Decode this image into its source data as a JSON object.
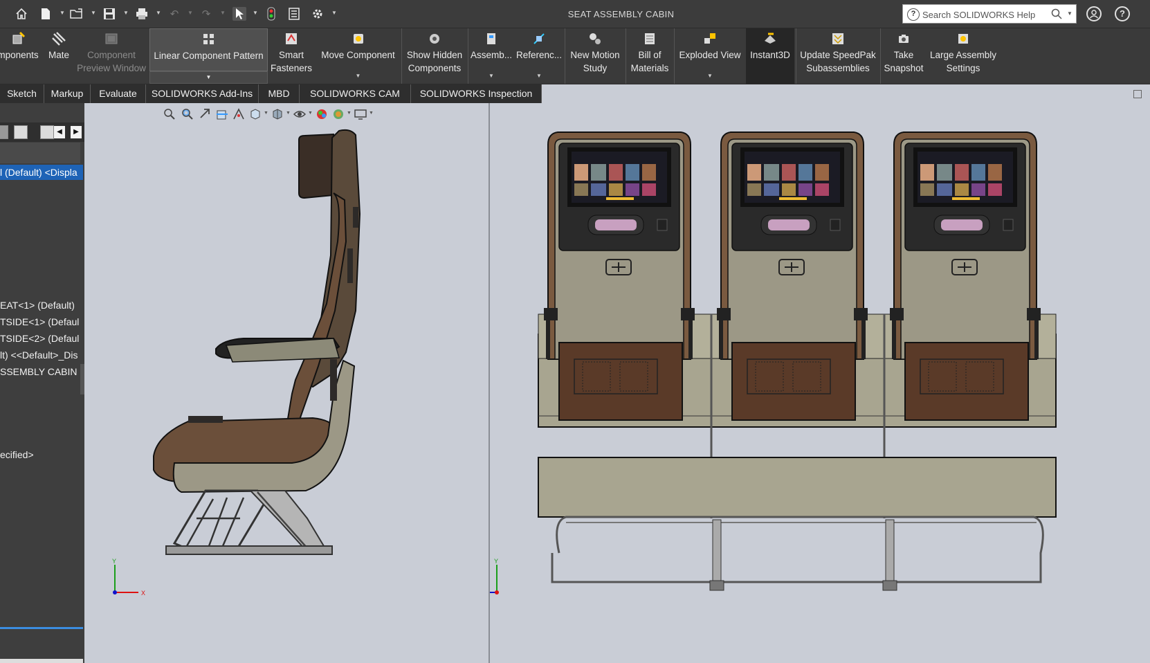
{
  "window": {
    "title": "SEAT ASSEMBLY CABIN",
    "search_placeholder": "Search SOLIDWORKS Help"
  },
  "quick_access": [
    {
      "icon": "home-icon"
    },
    {
      "icon": "new-document-icon"
    },
    {
      "icon": "open-icon"
    },
    {
      "icon": "save-icon"
    },
    {
      "icon": "print-icon"
    },
    {
      "icon": "undo-icon"
    },
    {
      "icon": "redo-icon"
    },
    {
      "icon": "select-icon"
    },
    {
      "icon": "rebuild-icon"
    },
    {
      "icon": "file-properties-icon"
    },
    {
      "icon": "options-gear-icon"
    }
  ],
  "ribbon": {
    "items": [
      {
        "id": "insert-components",
        "label_line1": "mponents",
        "label_line2": "",
        "icon": "insert-components-icon"
      },
      {
        "id": "mate",
        "label_line1": "Mate",
        "label_line2": "",
        "icon": "mate-icon"
      },
      {
        "id": "component-preview-window",
        "label_line1": "Component",
        "label_line2": "Preview Window",
        "icon": "component-preview-icon",
        "disabled": true
      },
      {
        "id": "linear-component-pattern",
        "label_line1": "Linear Component Pattern",
        "label_line2": "",
        "icon": "linear-pattern-icon"
      },
      {
        "id": "smart-fasteners",
        "label_line1": "Smart",
        "label_line2": "Fasteners",
        "icon": "smart-fasteners-icon"
      },
      {
        "id": "move-component",
        "label_line1": "Move Component",
        "label_line2": "",
        "icon": "move-component-icon"
      },
      {
        "id": "show-hidden-components",
        "label_line1": "Show Hidden",
        "label_line2": "Components",
        "icon": "show-hidden-icon"
      },
      {
        "id": "assembly-features",
        "label_line1": "Assemb...",
        "label_line2": "",
        "icon": "assembly-features-icon"
      },
      {
        "id": "reference-geometry",
        "label_line1": "Referenc...",
        "label_line2": "",
        "icon": "reference-geometry-icon"
      },
      {
        "id": "new-motion-study",
        "label_line1": "New Motion",
        "label_line2": "Study",
        "icon": "motion-study-icon"
      },
      {
        "id": "bill-of-materials",
        "label_line1": "Bill of",
        "label_line2": "Materials",
        "icon": "bom-icon"
      },
      {
        "id": "exploded-view",
        "label_line1": "Exploded View",
        "label_line2": "",
        "icon": "exploded-view-icon"
      },
      {
        "id": "instant3d",
        "label_line1": "Instant3D",
        "label_line2": "",
        "icon": "instant3d-icon",
        "pressed": true
      },
      {
        "id": "update-speedpak",
        "label_line1": "Update SpeedPak",
        "label_line2": "Subassemblies",
        "icon": "speedpak-icon"
      },
      {
        "id": "take-snapshot",
        "label_line1": "Take",
        "label_line2": "Snapshot",
        "icon": "camera-icon"
      },
      {
        "id": "large-assembly-settings",
        "label_line1": "Large Assembly",
        "label_line2": "Settings",
        "icon": "large-assembly-icon"
      }
    ]
  },
  "tabs": [
    "Sketch",
    "Markup",
    "Evaluate",
    "SOLIDWORKS Add-Ins",
    "MBD",
    "SOLIDWORKS CAM",
    "SOLIDWORKS Inspection"
  ],
  "feature_tree": {
    "rows": [
      {
        "text": "l (Default) <Displa",
        "selected": true
      },
      {
        "text": "EAT<1> (Default)"
      },
      {
        "text": "TSIDE<1> (Defaul"
      },
      {
        "text": "TSIDE<2> (Defaul"
      },
      {
        "text": "lt) <<Default>_Dis"
      },
      {
        "text": "SSEMBLY CABIN"
      },
      {
        "text": "ecified>"
      }
    ]
  },
  "view_toolbar": [
    {
      "icon": "zoom-to-fit-icon"
    },
    {
      "icon": "zoom-to-area-icon"
    },
    {
      "icon": "previous-view-icon"
    },
    {
      "icon": "section-view-icon"
    },
    {
      "icon": "dynamic-annotation-icon"
    },
    {
      "icon": "view-orientation-icon"
    },
    {
      "icon": "display-style-icon"
    },
    {
      "icon": "hide-show-items-icon"
    },
    {
      "icon": "edit-appearance-icon"
    },
    {
      "icon": "apply-scene-icon"
    },
    {
      "icon": "view-settings-icon"
    }
  ],
  "triad_left": {
    "y": "Y",
    "x": "X"
  },
  "triad_right": {
    "y": "Y",
    "z": "Z"
  }
}
